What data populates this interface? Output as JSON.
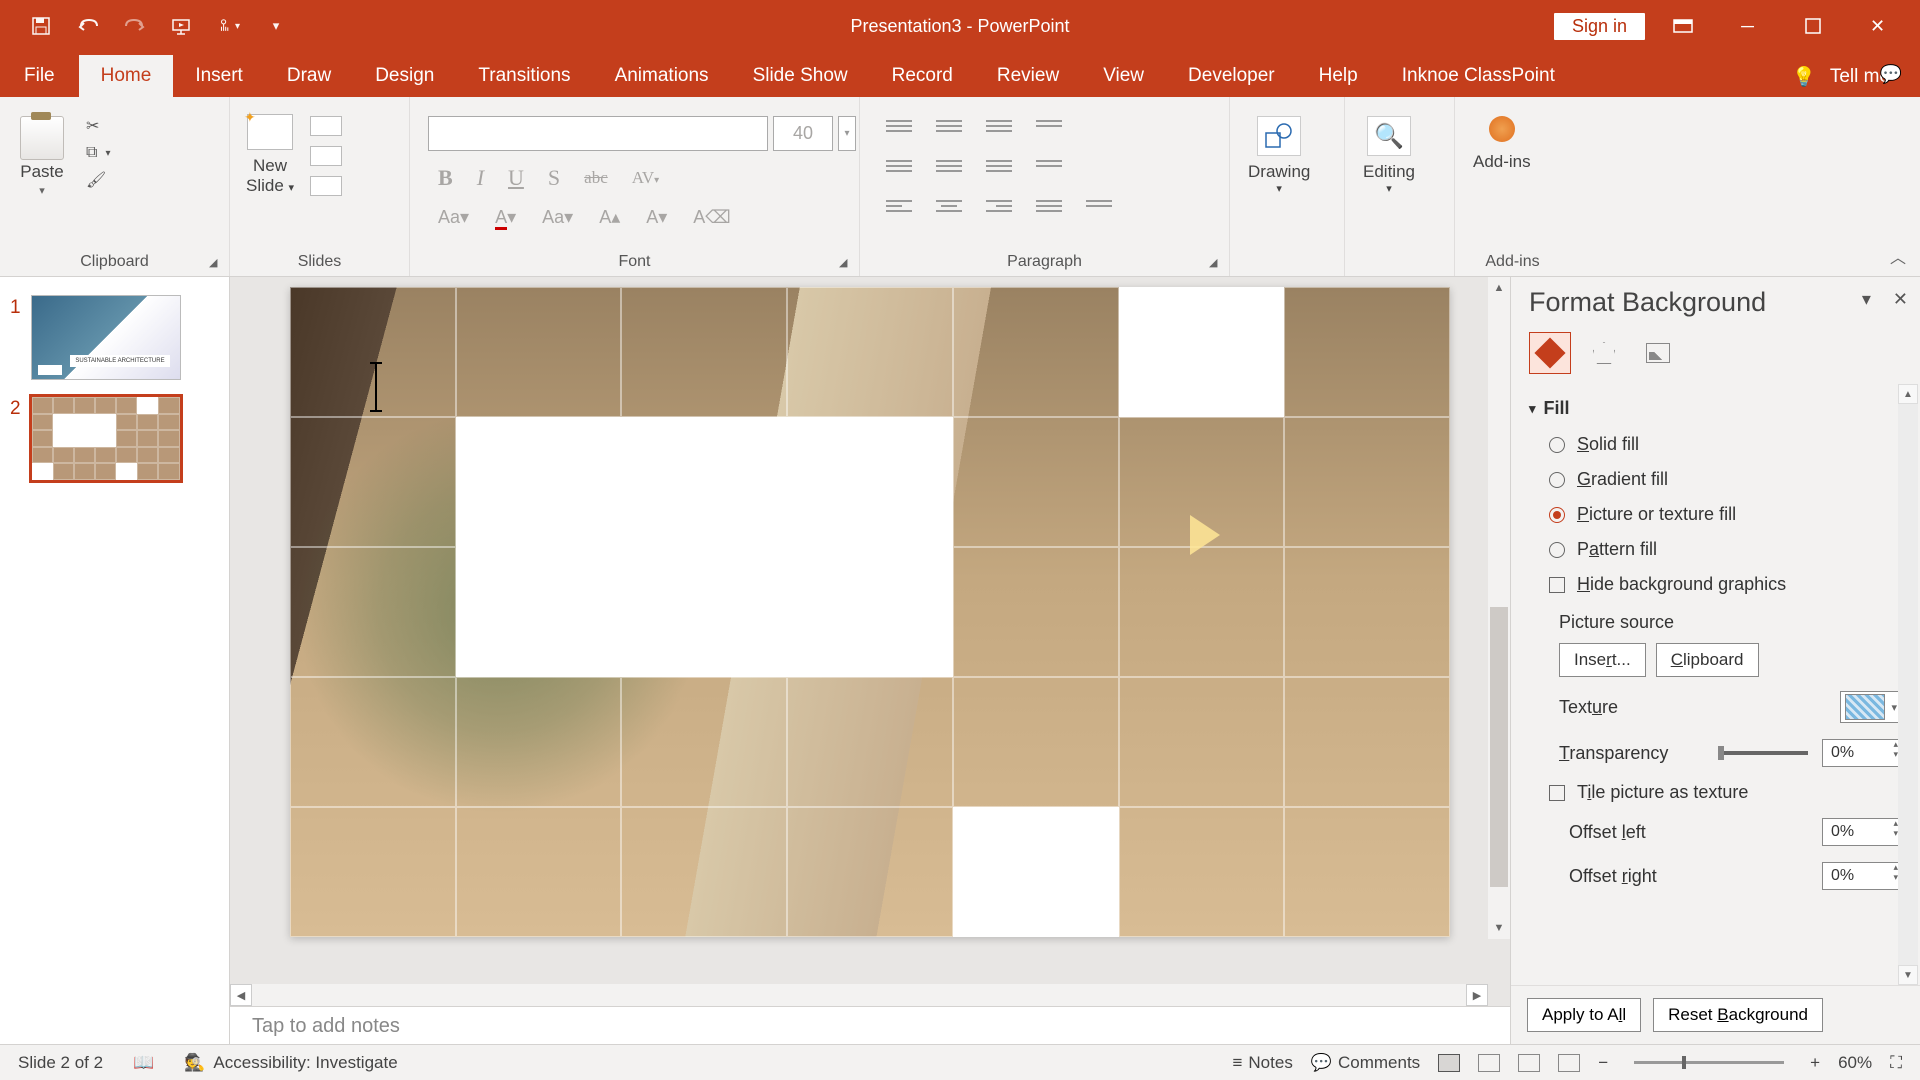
{
  "titlebar": {
    "doc_title": "Presentation3  -  PowerPoint",
    "sign_in": "Sign in"
  },
  "tabs": {
    "file": "File",
    "home": "Home",
    "insert": "Insert",
    "draw": "Draw",
    "design": "Design",
    "transitions": "Transitions",
    "animations": "Animations",
    "slideshow": "Slide Show",
    "record": "Record",
    "review": "Review",
    "view": "View",
    "developer": "Developer",
    "help": "Help",
    "classpoint": "Inknoe ClassPoint",
    "tell_me": "Tell me"
  },
  "ribbon": {
    "clipboard": {
      "label": "Clipboard",
      "paste": "Paste"
    },
    "slides": {
      "label": "Slides",
      "new_slide_l1": "New",
      "new_slide_l2": "Slide"
    },
    "font": {
      "label": "Font",
      "size_placeholder": "40"
    },
    "paragraph": {
      "label": "Paragraph"
    },
    "drawing": {
      "label": "Drawing"
    },
    "editing": {
      "label": "Editing"
    },
    "addins": {
      "label": "Add-ins",
      "btn": "Add-ins"
    }
  },
  "thumbs": {
    "n1": "1",
    "n2": "2",
    "slide1_caption": "SUSTAINABLE ARCHITECTURE"
  },
  "notes_placeholder": "Tap to add notes",
  "pane": {
    "title": "Format Background",
    "fill_hdr": "Fill",
    "solid": "Solid fill",
    "gradient": "Gradient fill",
    "picture": "Picture or texture fill",
    "pattern": "Pattern fill",
    "hide_bg": "Hide background graphics",
    "pic_source": "Picture source",
    "insert_btn": "Insert...",
    "clipboard_btn": "Clipboard",
    "texture": "Texture",
    "transparency": "Transparency",
    "transparency_val": "0%",
    "tile": "Tile picture as texture",
    "offset_left": "Offset left",
    "offset_left_val": "0%",
    "offset_right": "Offset right",
    "offset_right_val": "0%",
    "apply_all": "Apply to All",
    "reset": "Reset Background"
  },
  "statusbar": {
    "slide_pos": "Slide 2 of 2",
    "accessibility": "Accessibility: Investigate",
    "notes": "Notes",
    "comments": "Comments",
    "zoom": "60%"
  }
}
